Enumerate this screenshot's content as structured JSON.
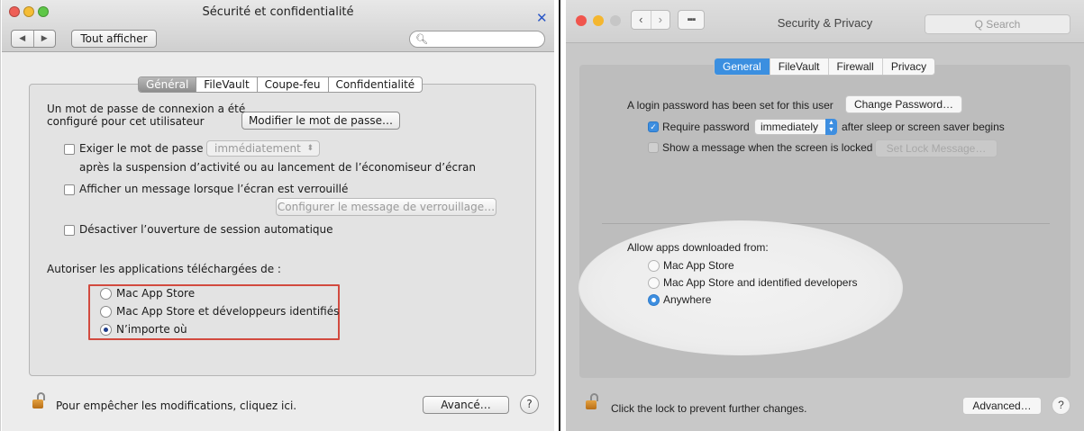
{
  "left": {
    "title": "Sécurité et confidentialité",
    "nav": {
      "back": "◀",
      "forward": "▶"
    },
    "show_all": "Tout afficher",
    "tabs": [
      "Général",
      "FileVault",
      "Coupe-feu",
      "Confidentialité"
    ],
    "password_text_line1": "Un mot de passe de connexion a été",
    "password_text_line2": "configuré pour cet utilisateur",
    "change_password_button": "Modifier le mot de passe…",
    "require_password_label": "Exiger le mot de passe",
    "require_password_value": "immédiatement",
    "require_password_suffix": "après la suspension d’activité ou au lancement de l’économiseur d’écran",
    "show_message_label": "Afficher un message lorsque l’écran est verrouillé",
    "set_lock_message_button": "Configurer le message de verrouillage…",
    "disable_auto_login_label": "Désactiver l’ouverture de session automatique",
    "allow_apps_heading": "Autoriser les applications téléchargées de :",
    "allow_apps_options": [
      "Mac App Store",
      "Mac App Store et développeurs identifiés",
      "N’importe où"
    ],
    "allow_apps_selected": 2,
    "lock_text": "Pour empêcher les modifications, cliquez ici.",
    "advanced_button": "Avancé…",
    "help_button": "?",
    "highlight_color": "#d24a3f"
  },
  "right": {
    "title": "Security & Privacy",
    "search_placeholder": "Q Search",
    "tabs": [
      "General",
      "FileVault",
      "Firewall",
      "Privacy"
    ],
    "password_text": "A login password has been set for this user",
    "change_password_button": "Change Password…",
    "require_password_label": "Require password",
    "require_password_value": "immediately",
    "require_password_suffix": "after sleep or screen saver begins",
    "show_message_label": "Show a message when the screen is locked",
    "set_lock_message_button": "Set Lock Message…",
    "allow_apps_heading": "Allow apps downloaded from:",
    "allow_apps_options": [
      "Mac App Store",
      "Mac App Store and identified developers",
      "Anywhere"
    ],
    "allow_apps_selected": 2,
    "lock_text": "Click the lock to prevent further changes.",
    "advanced_button": "Advanced…",
    "help_button": "?",
    "accent_color": "#3b8fe0"
  }
}
